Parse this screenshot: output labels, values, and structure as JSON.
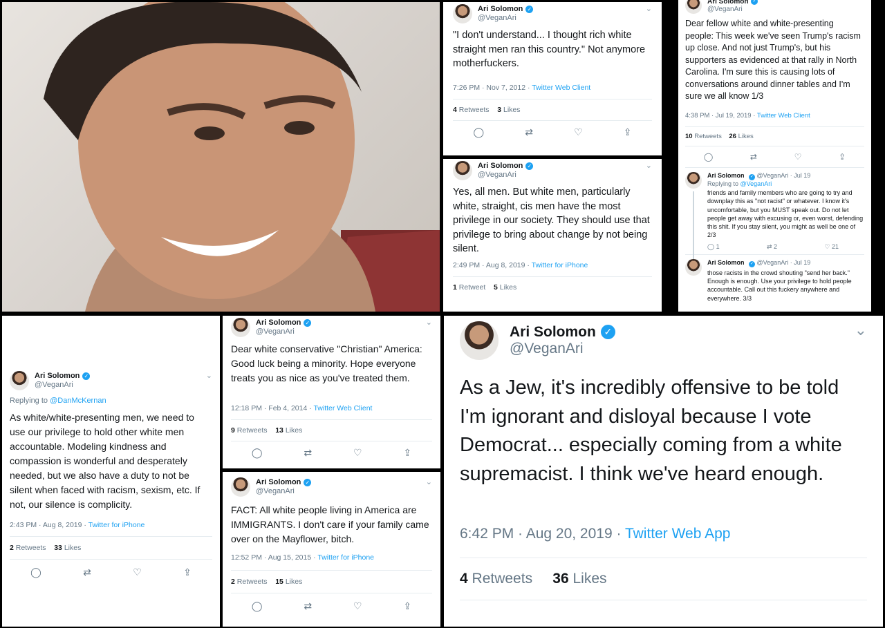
{
  "author": {
    "name": "Ari Solomon",
    "handle": "@VeganAri"
  },
  "icons": {
    "chevron": "chevron-down-icon",
    "verified": "verified-badge-icon",
    "reply": "reply-icon",
    "retweet": "retweet-icon",
    "like": "like-icon",
    "share": "share-icon"
  },
  "colors": {
    "link": "#1da1f2",
    "muted": "#657786",
    "text": "#14171a"
  },
  "tweets": {
    "t1": {
      "text": "\"I don't understand... I thought rich white straight men ran this country.\" Not anymore motherfuckers.",
      "time": "7:26 PM · Nov 7, 2012 · ",
      "source": "Twitter Web Client",
      "retweets": "4",
      "retweets_label": "Retweets",
      "likes": "3",
      "likes_label": "Likes"
    },
    "t2": {
      "text": "Yes, all men. But white men, particularly white, straight, cis men have the most privilege in our society. They should use that privilege to bring about change by not being silent.",
      "time": "2:49 PM · Aug 8, 2019 · ",
      "source": "Twitter for iPhone",
      "retweets": "1",
      "retweets_label": "Retweet",
      "likes": "5",
      "likes_label": "Likes"
    },
    "t3": {
      "text": "Dear fellow white and white-presenting people: This week we've seen Trump's racism up close. And not just Trump's, but his supporters as evidenced at that rally in North Carolina. I'm sure this is causing lots of conversations around dinner tables and I'm sure we all know 1/3",
      "time": "4:38 PM · Jul 19, 2019 · ",
      "source": "Twitter Web Client",
      "retweets": "10",
      "retweets_label": "Retweets",
      "likes": "26",
      "likes_label": "Likes"
    },
    "t3r1": {
      "date": "· Jul 19",
      "replying_prefix": "Replying to ",
      "replying_handle": "@VeganAri",
      "text": "friends and family members who are going to try and downplay this as \"not racist\" or whatever. I know it's uncomfortable, but you MUST speak out. Do not let people get away with excusing or, even worst, defending this shit. If you stay silent, you might as well be one of 2/3",
      "replies": "1",
      "retweets": "2",
      "likes": "21"
    },
    "t3r2": {
      "date": "· Jul 19",
      "text": "those racists in the crowd shouting \"send her back.\" Enough is enough. Use your privilege to hold people accountable. Call out this fuckery anywhere and everywhere. 3/3"
    },
    "t4": {
      "replying_prefix": "Replying to ",
      "replying_handle": "@DanMcKernan",
      "text": "As white/white-presenting men, we need to use our privilege to hold other white men accountable. Modeling kindness and compassion is wonderful and desperately needed, but we also have a duty to not be silent when faced with racism, sexism, etc. If not, our silence is complicity.",
      "time": "2:43 PM · Aug 8, 2019 · ",
      "source": "Twitter for iPhone",
      "retweets": "2",
      "retweets_label": "Retweets",
      "likes": "33",
      "likes_label": "Likes"
    },
    "t5": {
      "text": "Dear white conservative \"Christian\" America: Good luck being a minority. Hope everyone treats you as nice as you've treated them.",
      "time": "12:18 PM · Feb 4, 2014 · ",
      "source": "Twitter Web Client",
      "retweets": "9",
      "retweets_label": "Retweets",
      "likes": "13",
      "likes_label": "Likes"
    },
    "t6": {
      "text": "FACT: All white people living in America are IMMIGRANTS. I don't care if your family came over on the Mayflower, bitch.",
      "time": "12:52 PM · Aug 15, 2015 · ",
      "source": "Twitter for iPhone",
      "retweets": "2",
      "retweets_label": "Retweets",
      "likes": "15",
      "likes_label": "Likes"
    },
    "t7": {
      "text": "As a Jew, it's incredibly offensive to be told I'm ignorant and disloyal because I vote Democrat... especially coming from a white supremacist. I think we've heard enough.",
      "time": "6:42 PM · Aug 20, 2019 · ",
      "source": "Twitter Web App",
      "retweets": "4",
      "retweets_label": "Retweets",
      "likes": "36",
      "likes_label": "Likes"
    }
  }
}
